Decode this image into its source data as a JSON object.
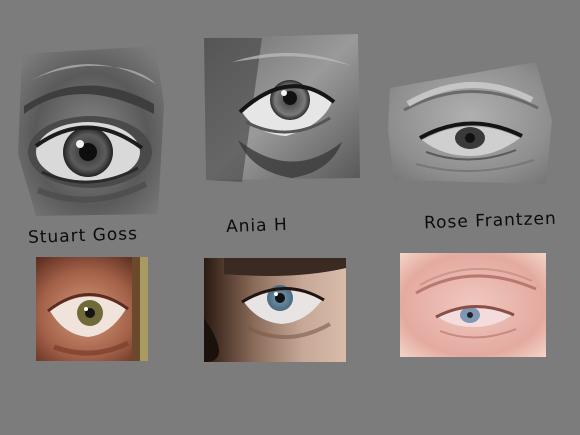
{
  "background_color": "#7c7c7c",
  "studies": [
    {
      "artist": "Stuart Goss",
      "sketch_icon": "graphite-wide-open-eye-drawing",
      "photo_icon": "wide-open-eye-photo"
    },
    {
      "artist": "Ania H",
      "sketch_icon": "graphite-upward-gaze-eye-drawing",
      "photo_icon": "upward-gaze-blue-eye-photo"
    },
    {
      "artist": "Rose Frantzen",
      "sketch_icon": "graphite-hooded-eye-drawing",
      "photo_icon": "hooded-blue-eye-photo"
    }
  ]
}
